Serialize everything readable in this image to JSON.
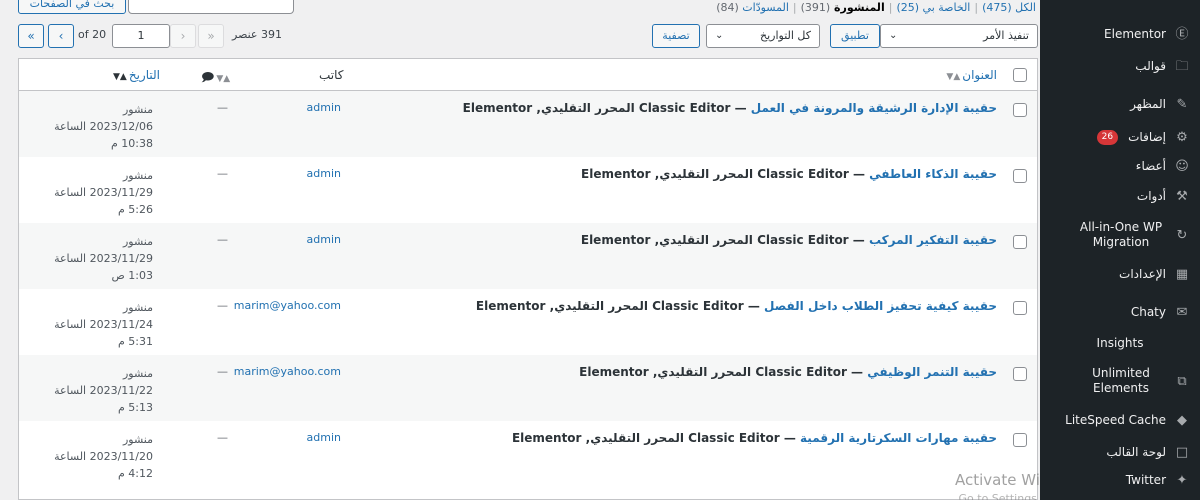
{
  "sidebar": {
    "items": [
      {
        "label": "Elementor",
        "icon": "elementor-icon"
      },
      {
        "label": "قوالب",
        "icon": "folder-icon"
      },
      {
        "label": "المظهر",
        "icon": "brush-icon"
      },
      {
        "label": "إضافات",
        "icon": "plugin-icon",
        "badge": "26"
      },
      {
        "label": "أعضاء",
        "icon": "user-icon"
      },
      {
        "label": "أدوات",
        "icon": "wrench-icon"
      },
      {
        "label": "All-in-One WP Migration",
        "icon": "migration-icon"
      },
      {
        "label": "الإعدادات",
        "icon": "settings-icon"
      },
      {
        "label": "Chaty",
        "icon": "chat-icon"
      },
      {
        "label": "Insights",
        "icon": ""
      },
      {
        "label": "Unlimited Elements",
        "icon": "unlimited-elements-icon"
      },
      {
        "label": "LiteSpeed Cache",
        "icon": "litespeed-icon"
      },
      {
        "label": "لوحة القالب",
        "icon": "panel-icon"
      },
      {
        "label": "Twitter",
        "icon": "twitter-icon"
      }
    ]
  },
  "top": {
    "search_button": "بحث في الصفحات"
  },
  "views": {
    "all": "الكل",
    "all_count": "(475)",
    "private": "الخاصة بي",
    "private_count": "(25)",
    "published": "المنشورة",
    "published_count": "(391)",
    "drafts": "المسودّات",
    "drafts_count": "(84)"
  },
  "toolbar": {
    "bulk_action": "تنفيذ الأمر",
    "apply": "تطبيق",
    "all_dates": "كل التواريخ",
    "filter": "تصفية",
    "item_count": "391 عنصر",
    "page_current": "1",
    "page_of": "of 20",
    "first_page": "«",
    "prev_page": "‹",
    "next_page": "›",
    "last_page": "»"
  },
  "table": {
    "headers": {
      "title": "العنوان",
      "author": "كاتب",
      "date": "التاريخ"
    },
    "rows": [
      {
        "title": "حقيبة الإدارة الرشيقة والمرونة في العمل",
        "suffix": " — Classic Editor المحرر التقليدي, Elementor",
        "author": "admin",
        "comments": "—",
        "status": "منشور",
        "date": "2023/12/06 الساعة",
        "time": "10:38 م"
      },
      {
        "title": "حقيبة الذكاء العاطفي",
        "suffix": " — Classic Editor المحرر التقليدي, Elementor",
        "author": "admin",
        "comments": "—",
        "status": "منشور",
        "date": "2023/11/29 الساعة",
        "time": "5:26 م"
      },
      {
        "title": "حقيبة التفكير المركب",
        "suffix": " — Classic Editor المحرر التقليدي, Elementor",
        "author": "admin",
        "comments": "—",
        "status": "منشور",
        "date": "2023/11/29 الساعة",
        "time": "1:03 ص"
      },
      {
        "title": "حقيبة كيفية تحفيز الطلاب داخل الفصل",
        "suffix": " — Classic Editor المحرر التقليدي, Elementor",
        "author": "marim@yahoo.com",
        "comments": "—",
        "status": "منشور",
        "date": "2023/11/24 الساعة",
        "time": "5:31 م"
      },
      {
        "title": "حقيبة التنمر الوظيفي",
        "suffix": " — Classic Editor المحرر التقليدي, Elementor",
        "author": "marim@yahoo.com",
        "comments": "—",
        "status": "منشور",
        "date": "2023/11/22 الساعة",
        "time": "5:13 م"
      },
      {
        "title": "حقيبة مهارات السكرتارية الرقمية",
        "suffix": " — Classic Editor المحرر التقليدي, Elementor",
        "author": "admin",
        "comments": "—",
        "status": "منشور",
        "date": "2023/11/20 الساعة",
        "time": "4:12 م"
      }
    ]
  },
  "watermark": {
    "line1": "Activate Windows",
    "line2": "Go to Settings to activate Windows."
  },
  "colors": {
    "sidebar_bg": "#1d2327",
    "link": "#2271b1",
    "badge": "#d63638"
  }
}
